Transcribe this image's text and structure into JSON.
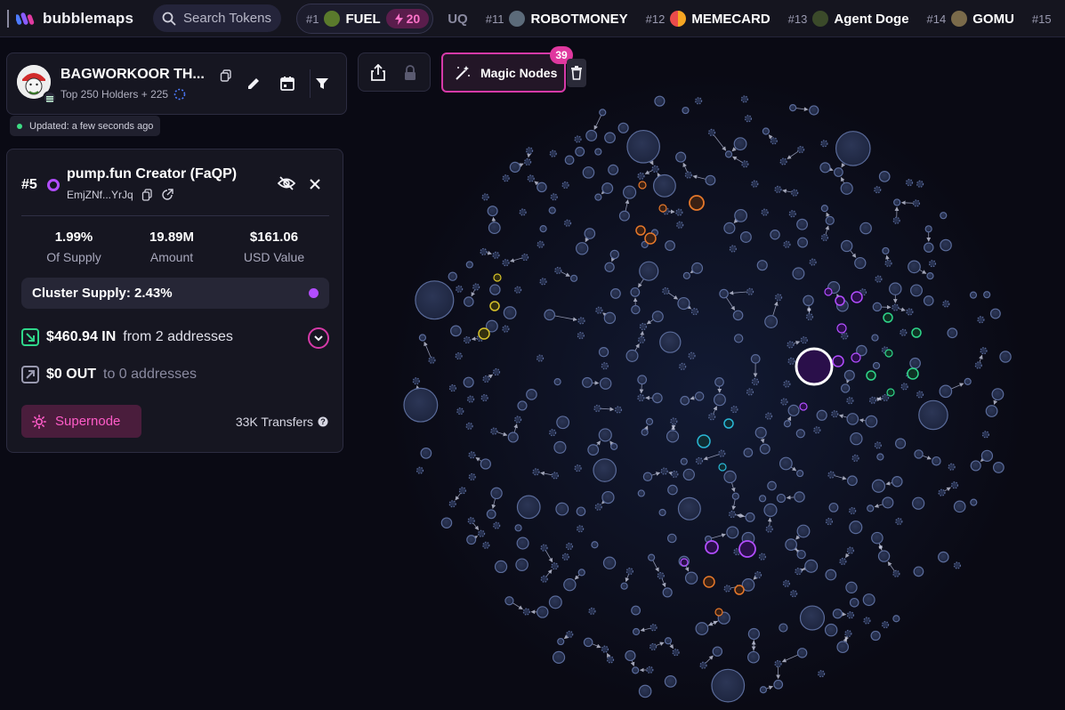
{
  "app": {
    "name": "bubblemaps"
  },
  "search": {
    "placeholder": "Search Tokens"
  },
  "ticker": [
    {
      "rank": "#1",
      "name": "FUEL",
      "boost": "20",
      "icon_color": "#5a7a2c"
    },
    {
      "rank": "",
      "name": "UQ",
      "icon_color": ""
    },
    {
      "rank": "#11",
      "name": "ROBOTMONEY",
      "icon_color": "#5c6b7a"
    },
    {
      "rank": "#12",
      "name": "MEMECARD",
      "icon_color": "#eb4b4b"
    },
    {
      "rank": "#13",
      "name": "Agent Doge",
      "icon_color": "#3b4a2a"
    },
    {
      "rank": "#14",
      "name": "GOMU",
      "icon_color": "#7a6a4a"
    },
    {
      "rank": "#15",
      "name": "",
      "icon_color": ""
    }
  ],
  "token": {
    "name": "BAGWORKOOR TH...",
    "subtitle": "Top 250 Holders + 225",
    "updated": "Updated: a few seconds ago"
  },
  "holder": {
    "rank": "#5",
    "name": "pump.fun Creator (FaQP)",
    "address": "EmjZNf...YrJq",
    "stats": [
      {
        "value": "1.99%",
        "label": "Of Supply"
      },
      {
        "value": "19.89M",
        "label": "Amount"
      },
      {
        "value": "$161.06",
        "label": "USD Value"
      }
    ],
    "cluster_supply": "Cluster Supply: 2.43%",
    "inflow": {
      "amount": "$460.94 IN",
      "text": "from 2 addresses"
    },
    "outflow": {
      "amount": "$0 OUT",
      "text": "to 0 addresses"
    },
    "supernode_label": "Supernode",
    "transfers": "33K Transfers"
  },
  "toolbar": {
    "magic_label": "Magic Nodes",
    "magic_count": "39"
  },
  "colors": {
    "accent": "#d63aa8",
    "purple": "#b24dff",
    "node": "#2a3350",
    "node_stroke": "#5a6b9a",
    "orange": "#e6782a",
    "green": "#2fd68a",
    "cyan": "#2ab8d6",
    "yellow": "#d6c22a"
  }
}
